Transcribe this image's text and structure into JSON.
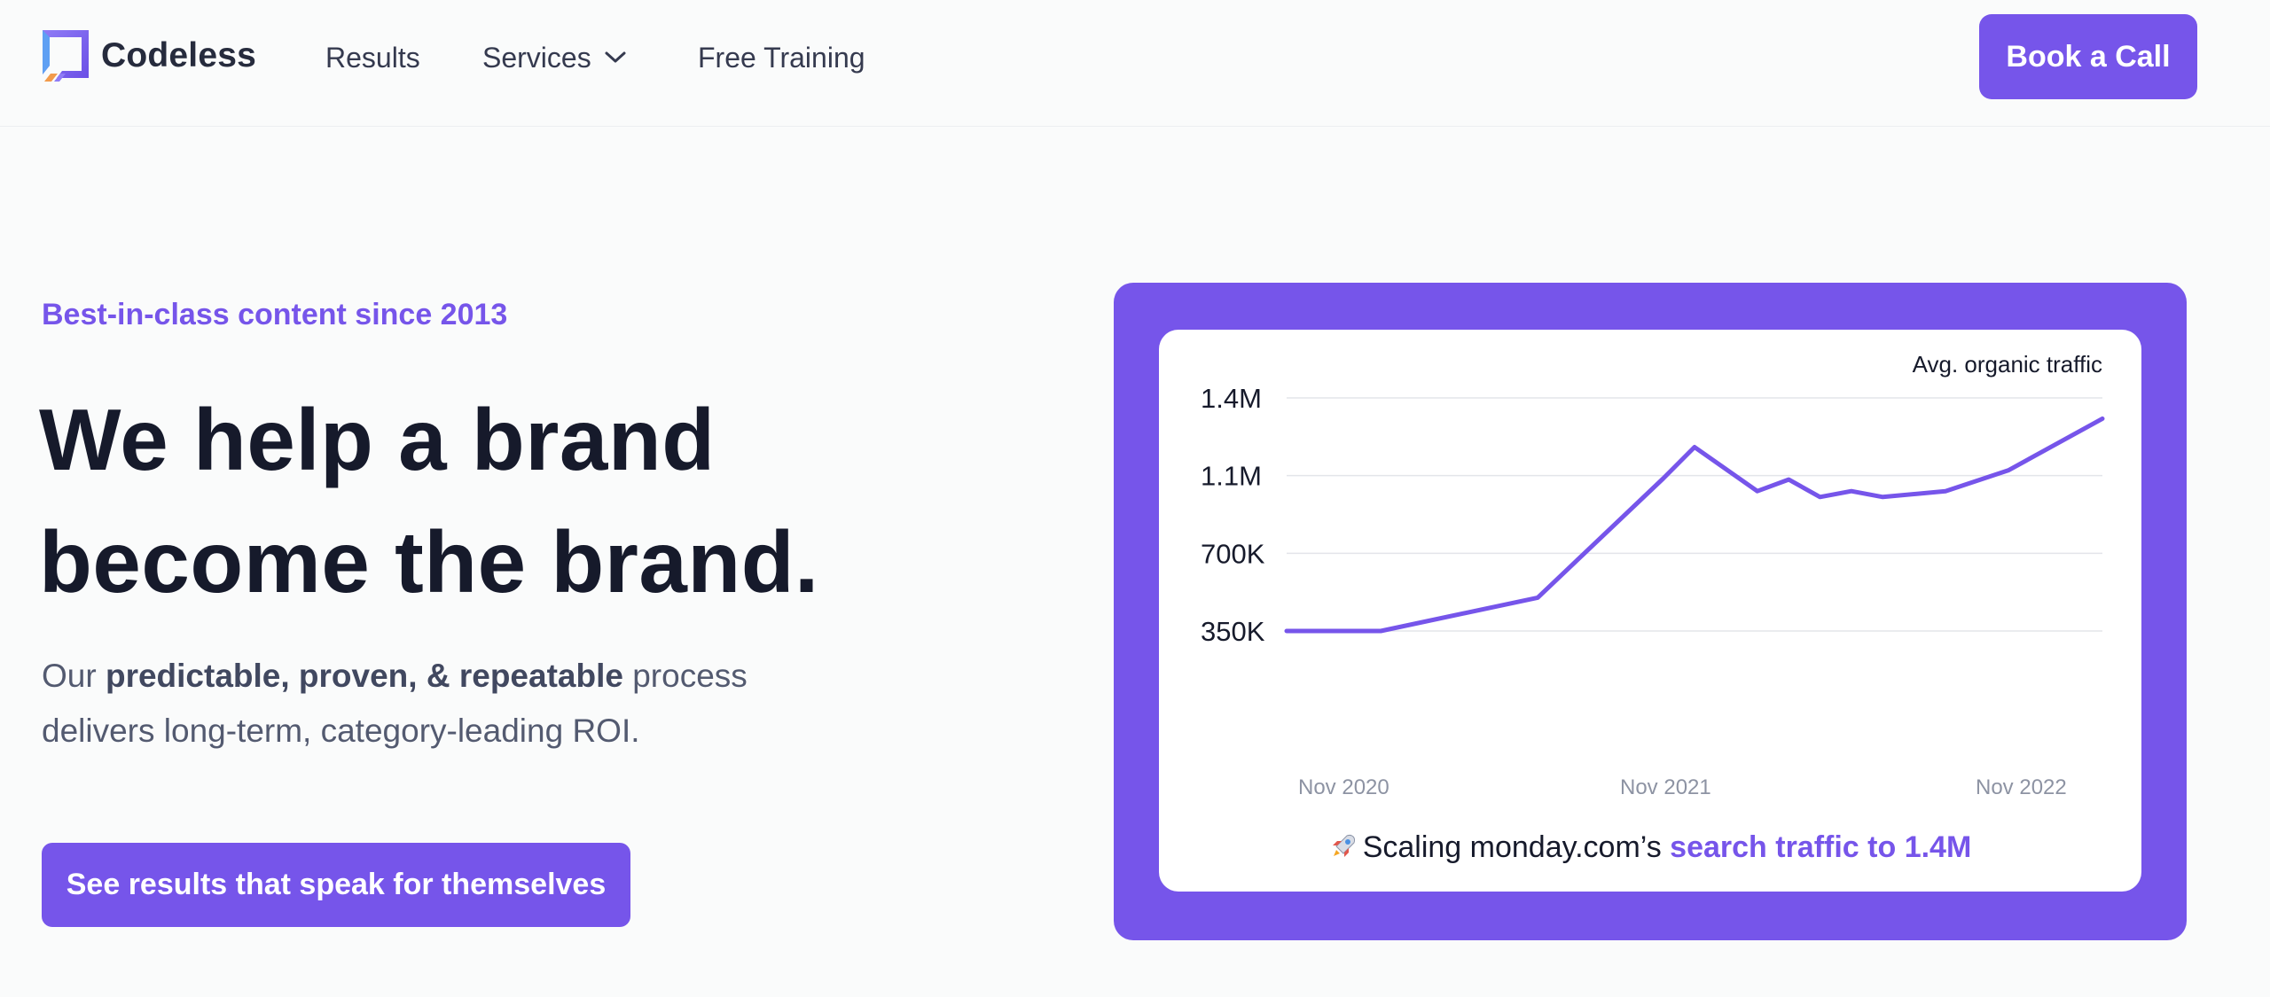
{
  "header": {
    "brand": "Codeless",
    "nav": {
      "results": "Results",
      "services": "Services",
      "free_training": "Free Training"
    },
    "cta": "Book a Call"
  },
  "hero": {
    "eyebrow": "Best-in-class content since 2013",
    "headline_line1": "We help a brand",
    "headline_line2": "become the brand.",
    "sub_lead": "Our ",
    "sub_bold": "predictable, proven, & repeatable",
    "sub_tail_line1": " process",
    "sub_line2": "delivers long-term, category-leading ROI.",
    "cta": "See results that speak for themselves"
  },
  "caption": {
    "prefix": "Scaling monday.com’s ",
    "highlight": "search traffic to 1.4M"
  },
  "colors": {
    "accent": "#7655ea",
    "text_dark": "#161a2b",
    "text_muted": "#535a70",
    "line": "#7655ea",
    "grid": "#e3e5ea"
  },
  "icons": {
    "logo": "codeless-square-logo-icon",
    "services_dropdown": "chevron-down-icon",
    "caption": "rocket-icon"
  },
  "chart_data": {
    "type": "line",
    "title": "",
    "legend": "Avg. organic traffic",
    "xlabel": "",
    "ylabel": "",
    "x_ticks": [
      "Nov 2020",
      "Nov 2021",
      "Nov 2022"
    ],
    "y_ticks": [
      {
        "value": 350000,
        "label": "350K"
      },
      {
        "value": 700000,
        "label": "700K"
      },
      {
        "value": 1100000,
        "label": "1.1M"
      },
      {
        "value": 1400000,
        "label": "1.4M"
      }
    ],
    "x_range": [
      "2020-10",
      "2022-12"
    ],
    "ylim": [
      350000,
      1400000
    ],
    "grid": true,
    "series": [
      {
        "name": "Avg. organic traffic",
        "points": [
          {
            "x": "2020-10",
            "y": 350000
          },
          {
            "x": "2020-11",
            "y": 350000
          },
          {
            "x": "2021-01",
            "y": 350000
          },
          {
            "x": "2021-06",
            "y": 500000
          },
          {
            "x": "2021-10",
            "y": 1085000
          },
          {
            "x": "2021-11",
            "y": 1210000
          },
          {
            "x": "2022-01",
            "y": 1020000
          },
          {
            "x": "2022-02",
            "y": 1080000
          },
          {
            "x": "2022-03",
            "y": 990000
          },
          {
            "x": "2022-04",
            "y": 1020000
          },
          {
            "x": "2022-05",
            "y": 990000
          },
          {
            "x": "2022-07",
            "y": 1020000
          },
          {
            "x": "2022-09",
            "y": 1120000
          },
          {
            "x": "2022-12",
            "y": 1320000
          }
        ]
      }
    ]
  }
}
